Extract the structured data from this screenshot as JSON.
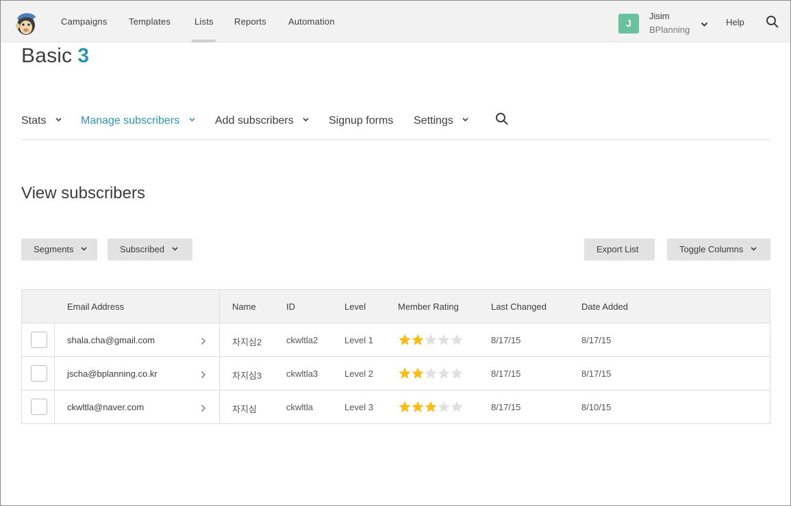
{
  "topnav": {
    "items": [
      "Campaigns",
      "Templates",
      "Lists",
      "Reports",
      "Automation"
    ],
    "active": "Lists",
    "user": {
      "initial": "J",
      "name": "Jisim",
      "org": "BPlanning"
    },
    "help_label": "Help"
  },
  "list": {
    "name": "Basic",
    "count": "3"
  },
  "subnav": {
    "items": [
      "Stats",
      "Manage subscribers",
      "Add subscribers",
      "Signup forms",
      "Settings"
    ],
    "active": "Manage subscribers"
  },
  "section_title": "View subscribers",
  "toolbar": {
    "segments_label": "Segments",
    "status_label": "Subscribed",
    "export_label": "Export List",
    "toggle_label": "Toggle Columns"
  },
  "table": {
    "columns": [
      "Email Address",
      "Name",
      "ID",
      "Level",
      "Member Rating",
      "Last Changed",
      "Date Added"
    ],
    "rows": [
      {
        "email": "shala.cha@gmail.com",
        "name": "차지심2",
        "id": "ckwltla2",
        "level": "Level 1",
        "rating": 2,
        "last_changed": "8/17/15",
        "date_added": "8/17/15"
      },
      {
        "email": "jscha@bplanning.co.kr",
        "name": "차지심3",
        "id": "ckwltla3",
        "level": "Level 2",
        "rating": 2,
        "last_changed": "8/17/15",
        "date_added": "8/17/15"
      },
      {
        "email": "ckwltla@naver.com",
        "name": "차지심",
        "id": "ckwltla",
        "level": "Level 3",
        "rating": 3,
        "last_changed": "8/17/15",
        "date_added": "8/10/15"
      }
    ],
    "rating_max": 5
  },
  "colors": {
    "accent": "#2f95ad",
    "avatar_bg": "#6ac1a1",
    "star_filled": "#f5be1a",
    "star_empty": "#e0e0e0"
  },
  "icons": {
    "logo": "mailchimp-monkey-logo",
    "search": "search-icon",
    "chevron": "chevron-down-icon",
    "row_arrow": "chevron-right-icon",
    "star": "star-icon"
  }
}
